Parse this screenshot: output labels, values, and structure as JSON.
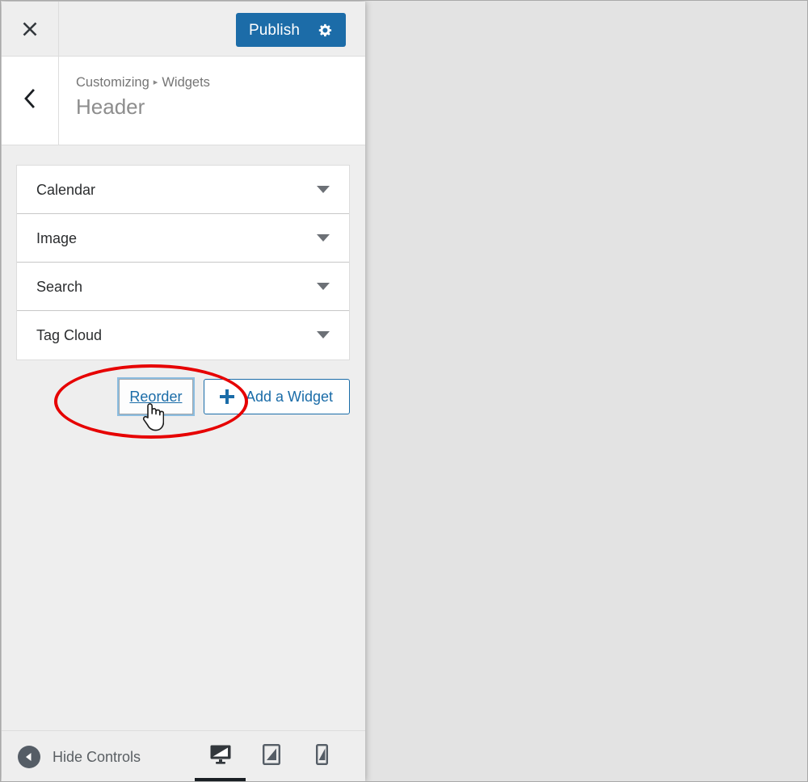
{
  "header": {
    "close_icon": "close-icon",
    "publish_label": "Publish",
    "gear_icon": "gear-icon",
    "accent_color": "#1c6ca8"
  },
  "section": {
    "back_icon": "chevron-left-icon",
    "breadcrumb_root": "Customizing",
    "breadcrumb_separator": "▸",
    "breadcrumb_current": "Widgets",
    "title": "Header"
  },
  "widgets": {
    "items": [
      {
        "label": "Calendar",
        "caret_icon": "chevron-down-icon"
      },
      {
        "label": "Image",
        "caret_icon": "chevron-down-icon"
      },
      {
        "label": "Search",
        "caret_icon": "chevron-down-icon"
      },
      {
        "label": "Tag Cloud",
        "caret_icon": "chevron-down-icon"
      }
    ]
  },
  "actions": {
    "reorder_label": "Reorder",
    "add_widget_label": "Add a Widget",
    "add_widget_icon": "plus-icon",
    "link_color": "#1a6ca8"
  },
  "footer": {
    "collapse_icon": "collapse-arrow-icon",
    "hide_controls_label": "Hide Controls",
    "devices": [
      {
        "name": "desktop-icon",
        "active": true
      },
      {
        "name": "tablet-icon",
        "active": false
      },
      {
        "name": "mobile-icon",
        "active": false
      }
    ]
  },
  "annotation": {
    "shape": "ellipse",
    "color": "#e60000",
    "cursor_icon": "pointing-hand-cursor"
  }
}
